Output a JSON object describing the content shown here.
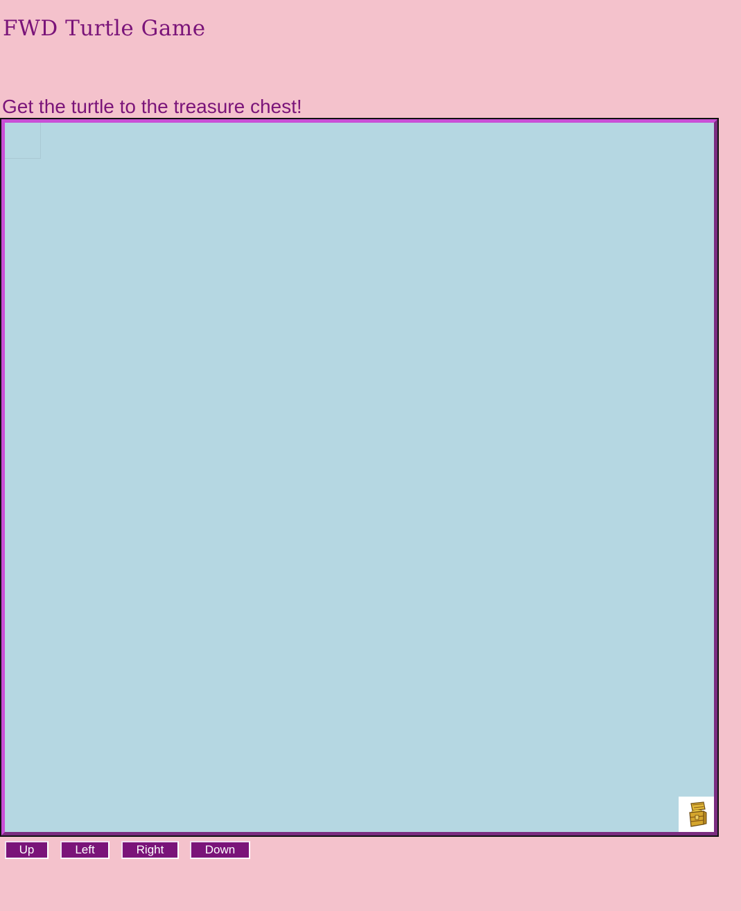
{
  "header": {
    "title": "FWD Turtle Game"
  },
  "game": {
    "instructions": "Get the turtle to the treasure chest!",
    "board": {
      "background_color": "#b5d7e2",
      "border_light_color": "#c94fd6",
      "border_dark_color": "#7b2d80",
      "turtle_icon": "turtle-icon",
      "goal_icon": "treasure-chest-icon"
    }
  },
  "controls": {
    "up_label": "Up",
    "left_label": "Left",
    "right_label": "Right",
    "down_label": "Down",
    "button_color": "#7a1479"
  },
  "theme": {
    "page_background": "#f4c2cc",
    "text_color": "#7a1479"
  }
}
